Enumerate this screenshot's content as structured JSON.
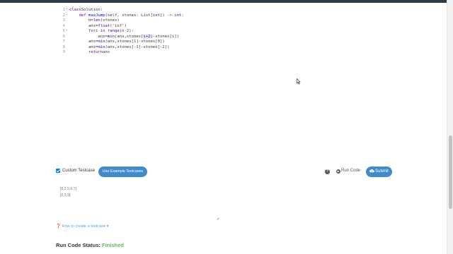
{
  "editor": {
    "lines": [
      {
        "n": "1",
        "fold": "▾",
        "segs": [
          [
            "kw",
            "class"
          ],
          [
            "",
            "Solution:"
          ]
        ]
      },
      {
        "n": "2",
        "fold": "▾",
        "segs": [
          [
            "",
            "    "
          ],
          [
            "kw",
            "def"
          ],
          [
            "",
            ""
          ],
          [
            "fn",
            "maxJump"
          ],
          [
            "",
            "(self, stones: "
          ],
          [
            "",
            "List"
          ],
          [
            "",
            "["
          ],
          [
            "bi",
            "int"
          ],
          [
            "",
            "]) "
          ],
          [
            "op",
            "->"
          ],
          [
            "",
            ""
          ],
          [
            "bi",
            "int"
          ],
          [
            "",
            ":"
          ]
        ]
      },
      {
        "n": "3",
        "fold": "",
        "segs": [
          [
            "",
            "        n="
          ],
          [
            "bi",
            "len"
          ],
          [
            "",
            "(stones)"
          ]
        ]
      },
      {
        "n": "4",
        "fold": "",
        "segs": [
          [
            "",
            "        ans="
          ],
          [
            "bi",
            "float"
          ],
          [
            "",
            "("
          ],
          [
            "str",
            "'inf'"
          ],
          [
            "",
            ")"
          ]
        ]
      },
      {
        "n": "5",
        "fold": "▾",
        "segs": [
          [
            "",
            "        "
          ],
          [
            "kw",
            "for"
          ],
          [
            "",
            "i "
          ],
          [
            "kw",
            "in"
          ],
          [
            "",
            ""
          ],
          [
            "bi",
            "range"
          ],
          [
            "",
            "(n-"
          ],
          [
            "num",
            "2"
          ],
          [
            "",
            "):"
          ]
        ]
      },
      {
        "n": "6",
        "fold": "",
        "segs": [
          [
            "",
            "            ans="
          ],
          [
            "bi",
            "min"
          ],
          [
            "",
            "(ans,stones["
          ],
          [
            "hl",
            "i+2"
          ],
          [
            "",
            "]-stones[i])"
          ]
        ]
      },
      {
        "n": "7",
        "fold": "",
        "segs": [
          [
            "",
            "        ans="
          ],
          [
            "bi",
            "min"
          ],
          [
            "",
            "(ans,stones["
          ],
          [
            "num",
            "1"
          ],
          [
            "",
            "]-stones["
          ],
          [
            "num",
            "0"
          ],
          [
            "",
            "])"
          ]
        ]
      },
      {
        "n": "8",
        "fold": "",
        "segs": [
          [
            "",
            "        ans="
          ],
          [
            "bi",
            "min"
          ],
          [
            "",
            "(ans,stones[-"
          ],
          [
            "num",
            "1"
          ],
          [
            "",
            "]-stones[-"
          ],
          [
            "num",
            "2"
          ],
          [
            "",
            "])"
          ]
        ]
      },
      {
        "n": "9",
        "fold": "",
        "segs": [
          [
            "",
            "        "
          ],
          [
            "kw",
            "return"
          ],
          [
            "",
            "ans"
          ]
        ]
      }
    ]
  },
  "testcase": {
    "custom_label": "Custom Testcase",
    "example_button": "Use Example Testcases",
    "help_glyph": "?",
    "run_code_label": "Run Code",
    "submit_label": "Submit",
    "values": [
      "[0,2,5,6,7]",
      "[0,3,9]"
    ]
  },
  "howto": "How to create a testcase",
  "status": {
    "label": "Run Code Status:",
    "value": "Finished"
  },
  "colors": {
    "accent": "#428bca",
    "success": "#5cb85c",
    "link": "#5aa2d6"
  }
}
